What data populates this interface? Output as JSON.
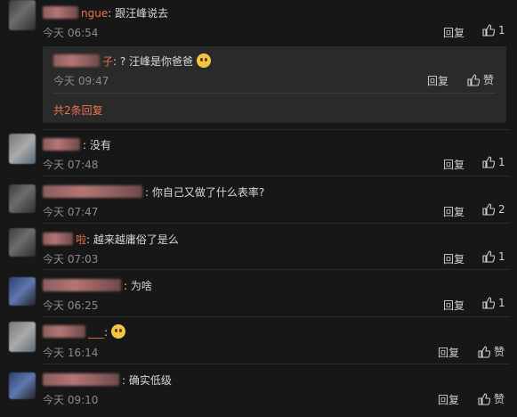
{
  "comments": [
    {
      "name_visible": "ngue",
      "text": "跟汪峰说去",
      "time": "今天 06:54",
      "reply": "回复",
      "likes": "1"
    },
    {
      "name_visible": "",
      "text": "没有",
      "time": "今天 07:48",
      "reply": "回复",
      "likes": "1"
    },
    {
      "name_visible": "",
      "text": "你自己又做了什么表率?",
      "time": "今天 07:47",
      "reply": "回复",
      "likes": "2"
    },
    {
      "name_visible": "啦",
      "text": "越来越庸俗了是么",
      "time": "今天 07:03",
      "reply": "回复",
      "likes": "1"
    },
    {
      "name_visible": "",
      "text": "为啥",
      "time": "今天 06:25",
      "reply": "回复",
      "likes": "1"
    },
    {
      "name_visible": "___",
      "text": "",
      "time": "今天 16:14",
      "reply": "回复",
      "likes": "赞"
    },
    {
      "name_visible": "",
      "text": "确实低级",
      "time": "今天 09:10",
      "reply": "回复",
      "likes": "赞"
    }
  ],
  "sub_reply": {
    "name_visible": "子",
    "text": "? 汪峰是你爸爸",
    "time": "今天 09:47",
    "reply": "回复",
    "likes": "赞",
    "more": "共2条回复"
  },
  "colors": {
    "accent": "#eb7350",
    "background": "#171717",
    "sub_box": "#2a2a2a"
  }
}
